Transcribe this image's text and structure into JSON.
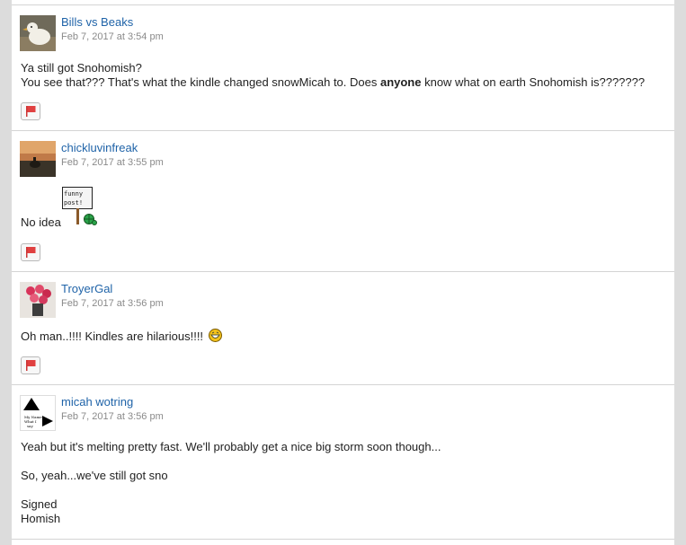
{
  "posts": [
    {
      "author": "Bills vs Beaks",
      "time": "Feb 7, 2017 at 3:54 pm",
      "line1": "Ya still got Snohomish?",
      "line2_before": "You see that??? That's what the kindle changed snowMicah to. Does ",
      "line2_bold": "anyone",
      "line2_after": " know what on earth Snohomish is???????"
    },
    {
      "author": "chickluvinfreak",
      "time": "Feb 7, 2017 at 3:55 pm",
      "text": "No idea",
      "sign_text": "funny post!"
    },
    {
      "author": "TroyerGal",
      "time": "Feb 7, 2017 at 3:56 pm",
      "text": "Oh man..!!!! Kindles are hilarious!!!!"
    },
    {
      "author": "micah wotring",
      "time": "Feb 7, 2017 at 3:56 pm",
      "avatar_text": "My Name What I say",
      "lines": [
        "Yeah but it's melting pretty fast. We'll probably get a nice big storm soon though...",
        "So, yeah...we've still got sno",
        "Signed",
        "Homish"
      ]
    }
  ],
  "colors": {
    "link": "#1f63a8",
    "flag": "#e04040",
    "meta": "#8a8a8a"
  },
  "icons": {
    "flag": "flag-icon",
    "smiley": "laughing-smiley-icon",
    "sign": "funny-post-sign-icon"
  }
}
